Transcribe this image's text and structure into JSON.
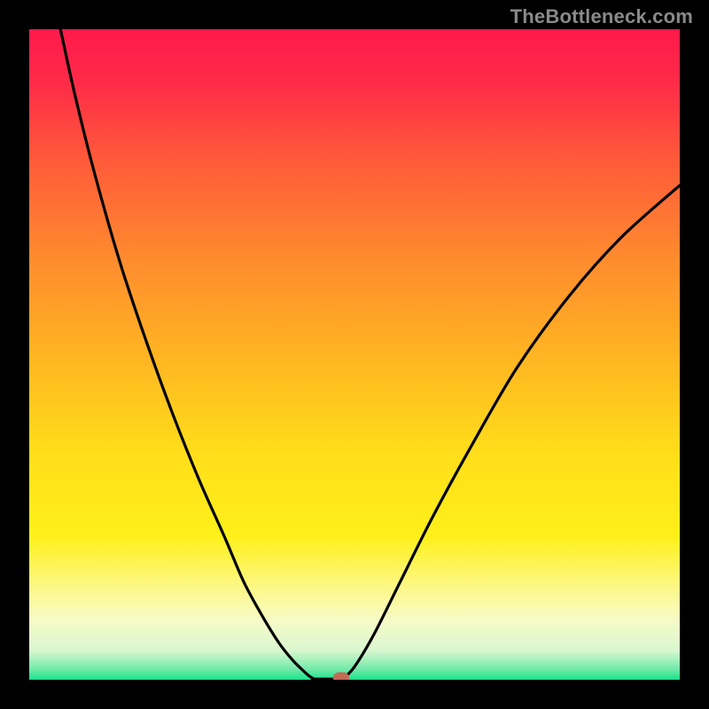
{
  "watermark": "TheBottleneck.com",
  "colors": {
    "black": "#000000",
    "stroke": "#000000",
    "marker": "#c36a56"
  },
  "chart_data": {
    "type": "line",
    "title": "",
    "xlabel": "",
    "ylabel": "",
    "xlim": [
      0,
      100
    ],
    "ylim": [
      0,
      100
    ],
    "gradient_stops": [
      {
        "pos": 0.0,
        "color": "#ff1a4b"
      },
      {
        "pos": 0.08,
        "color": "#ff2a48"
      },
      {
        "pos": 0.2,
        "color": "#ff5a3a"
      },
      {
        "pos": 0.35,
        "color": "#ff8a2e"
      },
      {
        "pos": 0.5,
        "color": "#ffb422"
      },
      {
        "pos": 0.65,
        "color": "#ffdd1a"
      },
      {
        "pos": 0.78,
        "color": "#fff01a"
      },
      {
        "pos": 0.86,
        "color": "#fdf88a"
      },
      {
        "pos": 0.91,
        "color": "#f6fbc8"
      },
      {
        "pos": 0.955,
        "color": "#d9f7d0"
      },
      {
        "pos": 0.985,
        "color": "#6ee9a7"
      },
      {
        "pos": 1.0,
        "color": "#17e38b"
      }
    ],
    "series": [
      {
        "name": "left-branch",
        "x": [
          4.8,
          7,
          10,
          14,
          18,
          22,
          26,
          30,
          33,
          36,
          38.5,
          40.5,
          42,
          43,
          43.8
        ],
        "y": [
          100,
          90,
          78,
          64,
          52,
          41,
          31,
          22,
          15,
          9.5,
          5.5,
          3,
          1.5,
          0.6,
          0.1
        ]
      },
      {
        "name": "floor",
        "x": [
          43.8,
          48.2
        ],
        "y": [
          0.1,
          0.1
        ]
      },
      {
        "name": "right-branch",
        "x": [
          48.2,
          50,
          53,
          57,
          62,
          68,
          75,
          83,
          91,
          100
        ],
        "y": [
          0.1,
          2,
          7,
          15,
          25,
          36,
          48,
          59,
          68,
          76
        ]
      }
    ],
    "marker": {
      "x": 48.0,
      "y": 0.3
    }
  }
}
